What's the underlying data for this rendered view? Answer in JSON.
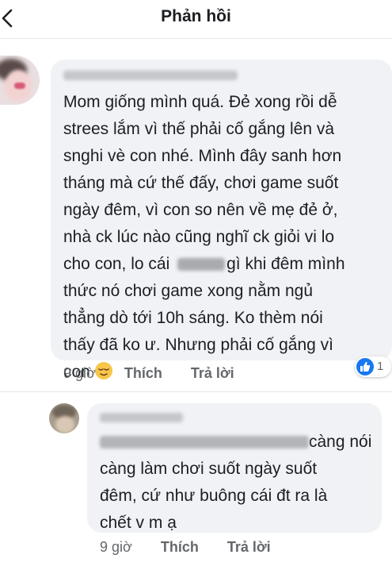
{
  "header": {
    "title": "Phản hồi",
    "back_icon": "chevron-left-icon"
  },
  "comment": {
    "text_lines": [
      "Mom giống mình quá. Đẻ xong rồi dễ",
      "strees lắm vì thế phải cố gắng lên và",
      "snghi vè con nhé. Mình đây sanh hơn",
      "tháng mà cứ thế đấy, chơi game suốt",
      "ngày đêm, vì con so nên về mẹ đẻ ở,",
      "nhà ck lúc nào cũng nghĩ ck giỏi vi lo",
      "cho con, lo cái",
      "gì khi đêm mình",
      "thức nó chơi game xong nằm ngủ",
      "thẳng dò tới 10h sáng. Ko thèm nói",
      "thấy đã ko ư. Nhưng phải cố gắng vì",
      "con"
    ],
    "emoji_icon": "relieved-face-emoji-icon",
    "time": "9 giờ",
    "like_label": "Thích",
    "reply_label": "Trả lời",
    "reaction_icon": "like-reaction-icon",
    "reaction_count": "1",
    "reaction_color": "#1877f2"
  },
  "reply": {
    "text_lines": [
      "càng nói",
      "càng làm chơi suốt ngày suốt",
      "đêm, cứ như buông cái đt ra là",
      "chết v m ạ"
    ],
    "time": "9 giờ",
    "like_label": "Thích",
    "reply_label": "Trả lời"
  }
}
